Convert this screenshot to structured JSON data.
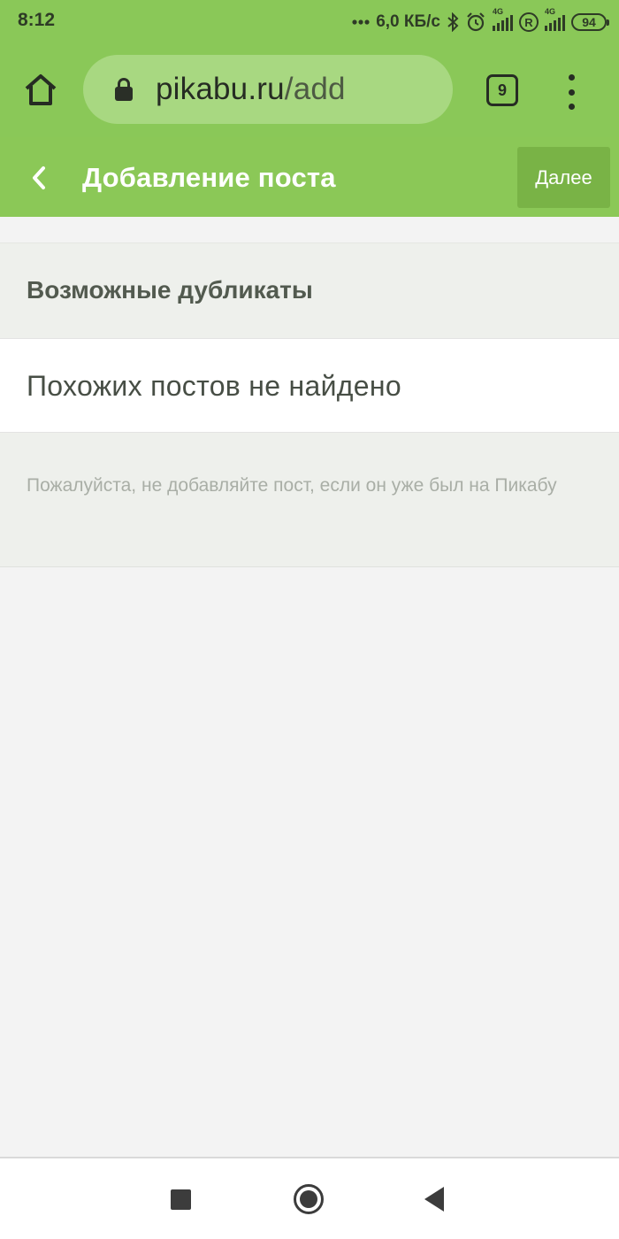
{
  "status_bar": {
    "time": "8:12",
    "network_speed": "6,0 КБ/с",
    "sim1_type": "4G",
    "sim2_type": "4G",
    "roaming_badge": "R",
    "battery": "94",
    "icons": [
      "dots-icon",
      "bluetooth-icon",
      "alarm-icon",
      "signal-icon",
      "roaming-icon",
      "signal-icon",
      "battery-icon"
    ]
  },
  "browser": {
    "url_host": "pikabu.ru",
    "url_path": "/add",
    "tab_count": "9",
    "icons": [
      "home-icon",
      "lock-icon",
      "tabs-icon",
      "menu-icon"
    ]
  },
  "app_bar": {
    "title": "Добавление поста",
    "next_label": "Далее",
    "icons": [
      "back-arrow-icon"
    ]
  },
  "content": {
    "section_title": "Возможные дубликаты",
    "result_text": "Похожих постов не найдено",
    "notice_text": "Пожалуйста, не добавляйте пост, если он уже был на Пикабу"
  },
  "nav_bar": {
    "icons": [
      "recents-square-icon",
      "home-circle-icon",
      "back-triangle-icon"
    ]
  },
  "colors": {
    "brand_green": "#8bc857",
    "button_green": "#79b346",
    "url_pill": "#a8d881",
    "page_background": "#f3f3f3"
  }
}
